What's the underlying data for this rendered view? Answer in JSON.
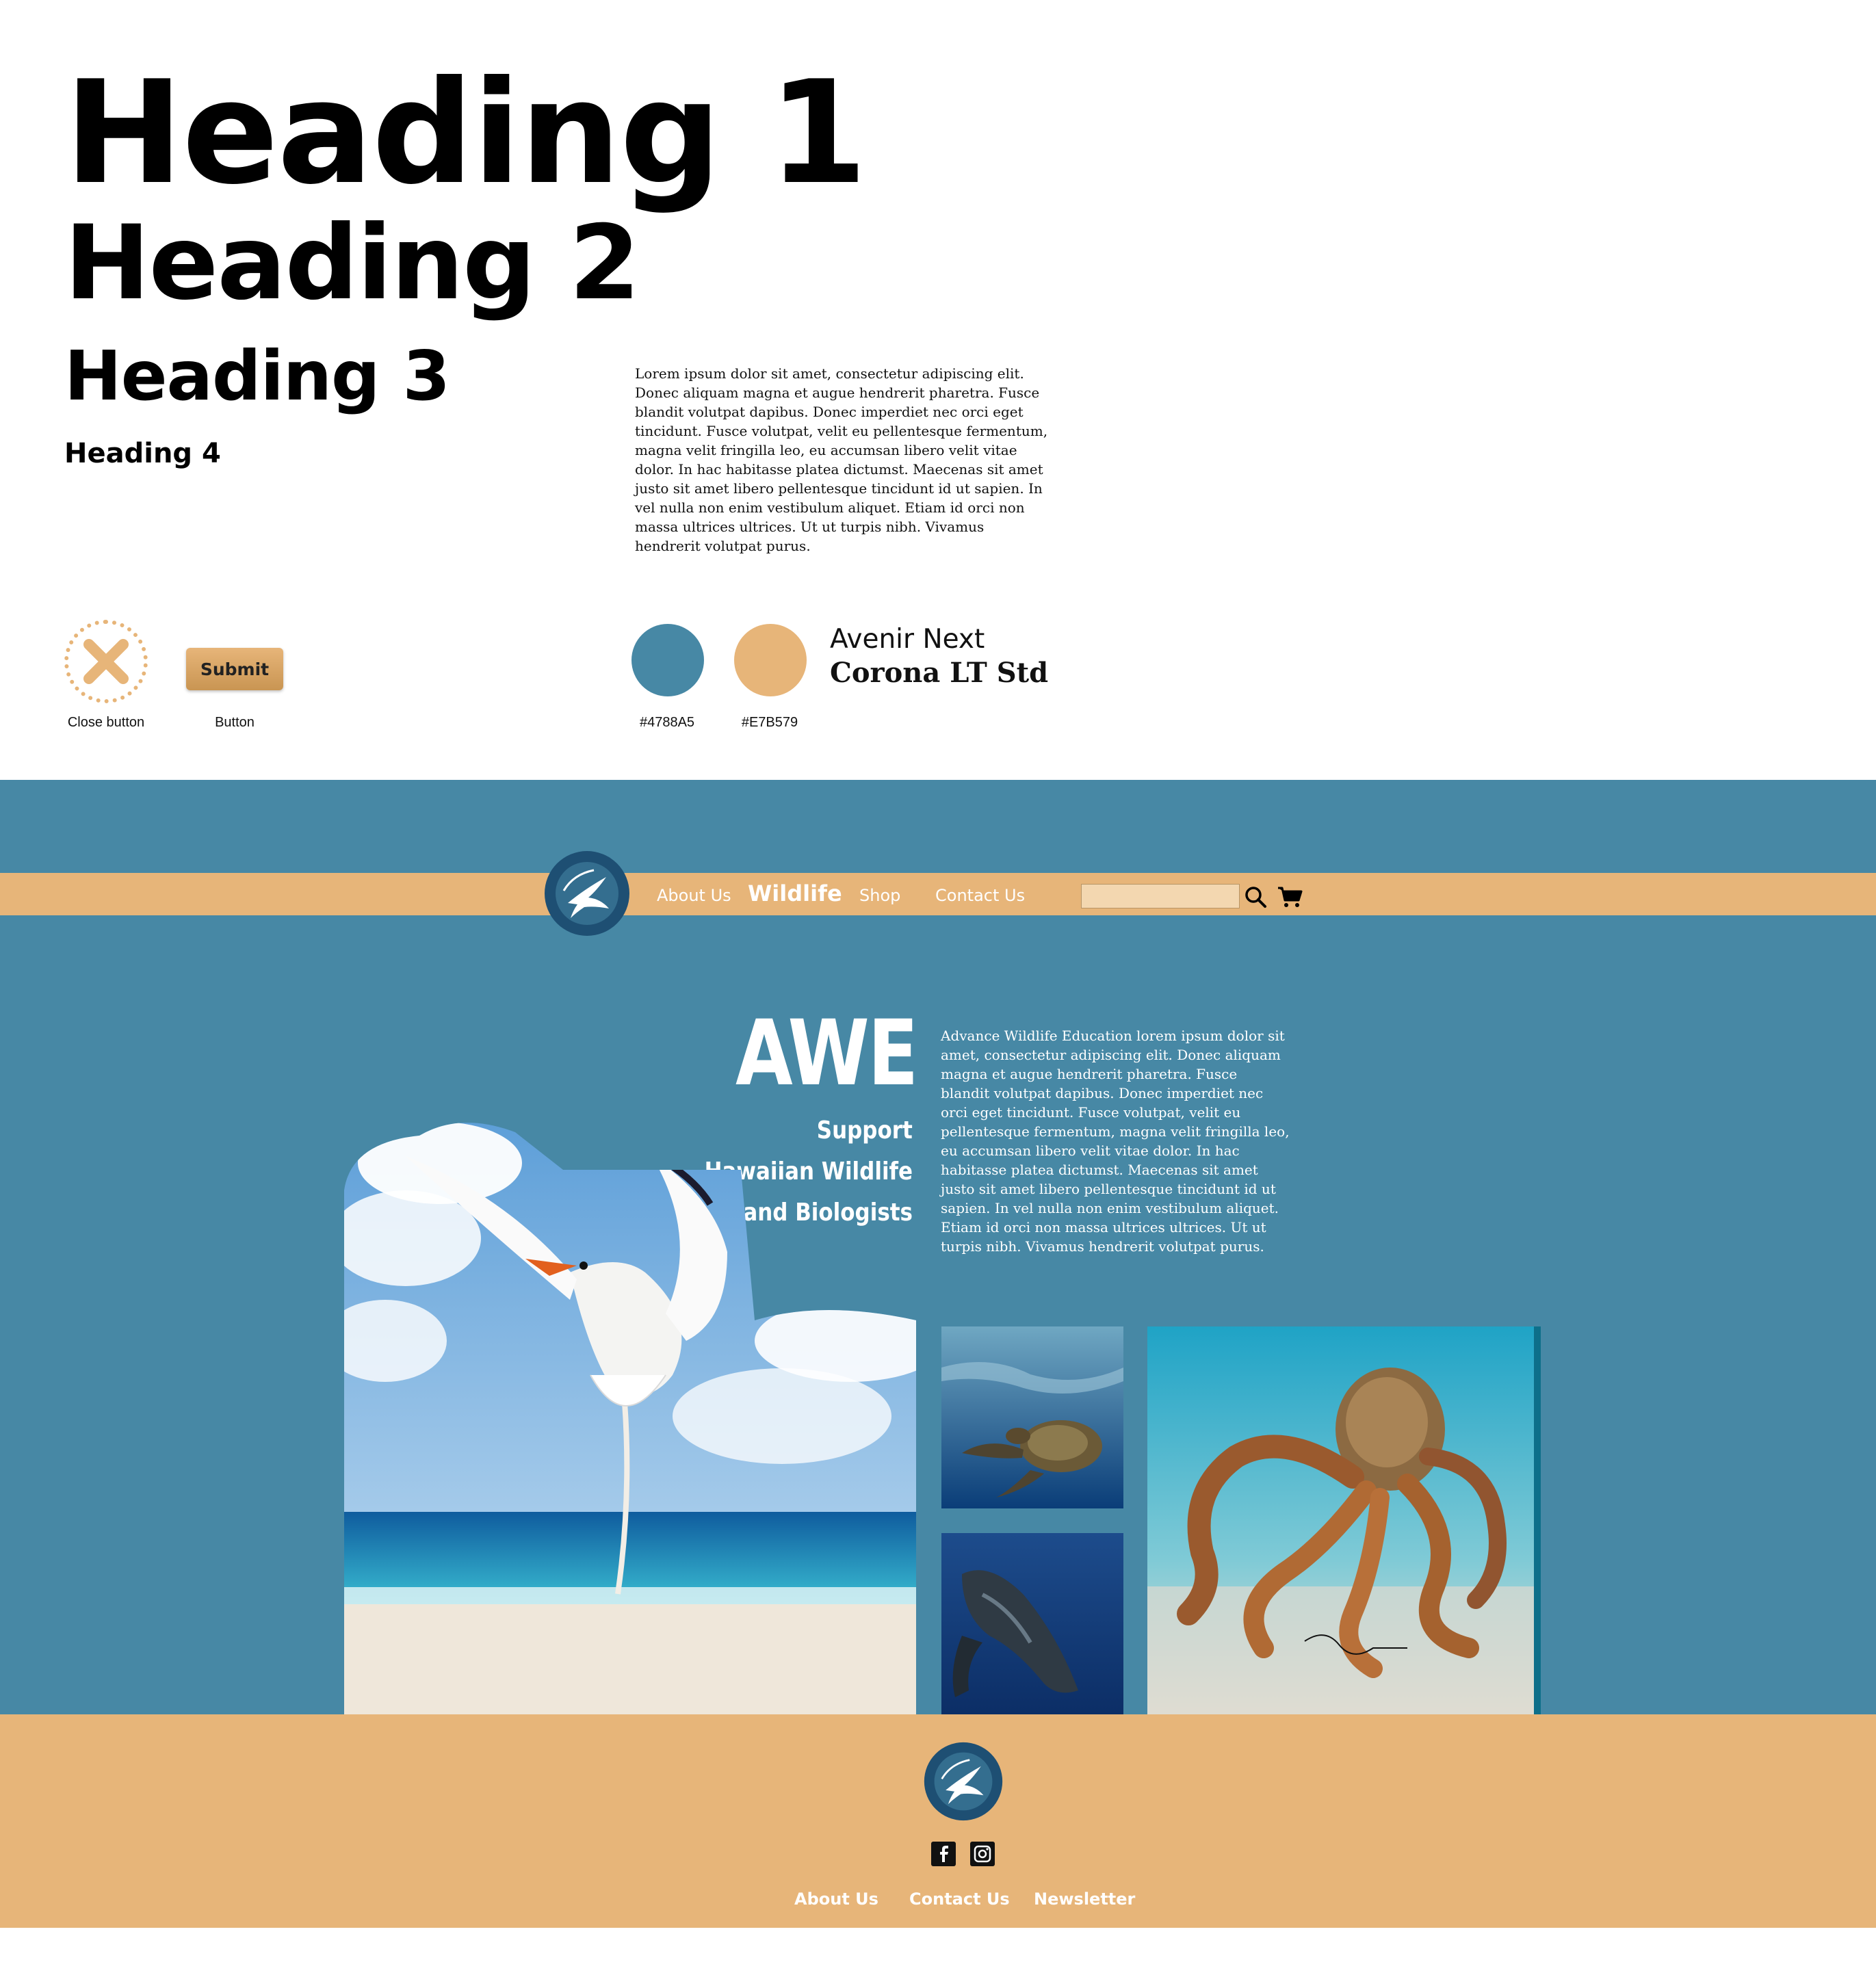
{
  "style_guide": {
    "headings": {
      "h1": "Heading 1",
      "h2": "Heading 2",
      "h3": "Heading 3",
      "h4": "Heading 4"
    },
    "body_sample": "Lorem ipsum dolor sit amet, consectetur adipiscing elit. Donec aliquam magna et augue hendrerit pharetra. Fusce blandit volutpat dapibus. Donec imperdiet nec orci eget tincidunt. Fusce volutpat, velit eu pellentesque fermentum, magna velit fringilla leo, eu accumsan libero velit vitae dolor. In hac habitasse platea dictumst. Maecenas sit amet justo sit amet libero pellentesque tincidunt id ut sapien. In vel nulla non enim vestibulum aliquet. Etiam id orci non massa ultrices ultrices. Ut ut turpis nibh. Vivamus hendrerit volutpat purus.",
    "close_button_caption": "Close button",
    "submit_label": "Submit",
    "button_caption": "Button",
    "swatches": [
      {
        "label": "#4788A5",
        "color": "#4788A5"
      },
      {
        "label": "#E7B579",
        "color": "#E7B579"
      }
    ],
    "fonts": {
      "sans": "Avenir Next",
      "serif": "Corona LT Std"
    }
  },
  "site": {
    "colors": {
      "primary": "#4788A5",
      "accent": "#E7B579",
      "logo_navy": "#1E4F73"
    },
    "nav": {
      "items": [
        "About Us",
        "Wildlife",
        "Shop",
        "Contact Us"
      ],
      "active": "Wildlife",
      "search_placeholder": "",
      "icons": [
        "search-icon",
        "cart-icon"
      ]
    },
    "hero": {
      "title": "AWE",
      "subtitle_lines": [
        "Support",
        "Hawaiian Wildlife",
        "and Biologists"
      ],
      "paragraph": "Advance Wildlife Education lorem ipsum dolor sit amet, consectetur adipiscing elit. Donec aliquam magna et augue hendrerit pharetra. Fusce blandit volutpat dapibus. Donec imperdiet nec orci eget tincidunt. Fusce volutpat, velit eu pellentesque fermentum, magna velit fringilla leo, eu accumsan libero velit vitae dolor. In hac habitasse platea dictumst. Maecenas sit amet justo sit amet libero pellentesque tincidunt id ut sapien. In vel nulla non enim vestibulum aliquet. Etiam id orci non massa ultrices ultrices. Ut ut turpis nibh. Vivamus hendrerit volutpat purus."
    },
    "photos": [
      "tropicbird-beach",
      "sea-turtle",
      "humpback-whale",
      "octopus"
    ],
    "footer": {
      "social_icons": [
        "facebook-icon",
        "instagram-icon"
      ],
      "links": [
        "About Us",
        "Contact Us",
        "Newsletter"
      ]
    }
  }
}
